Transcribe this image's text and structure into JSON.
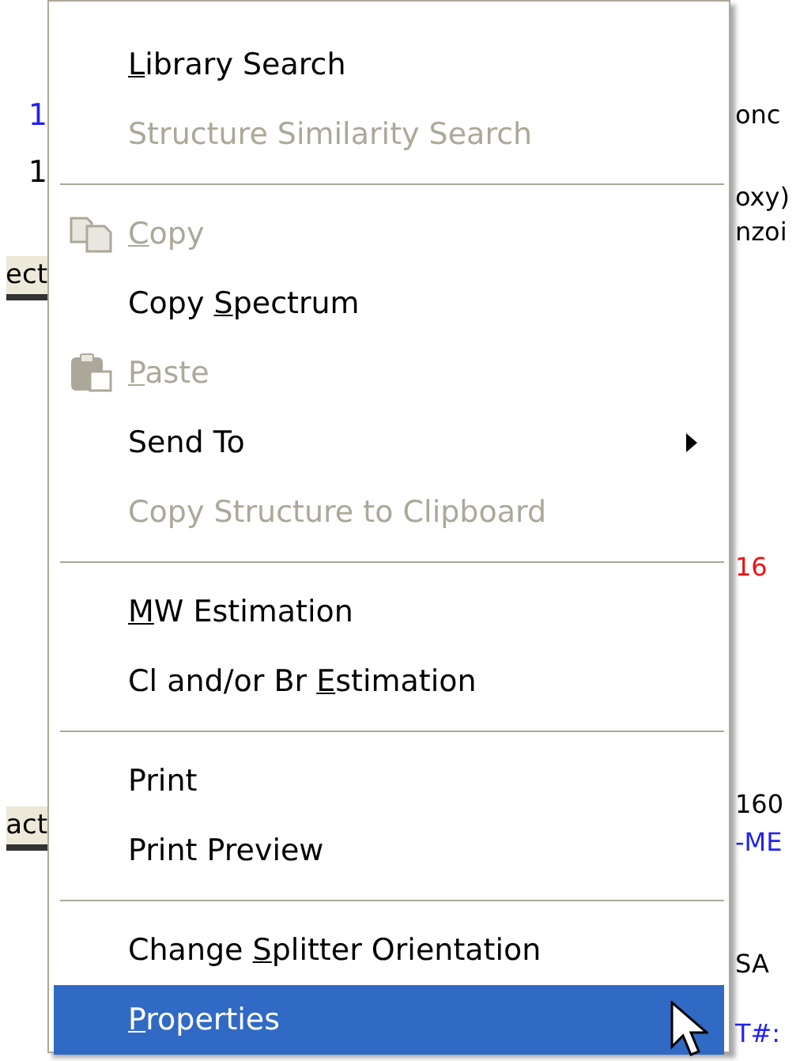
{
  "background": {
    "left": [
      {
        "text": "1",
        "kind": "link"
      },
      {
        "text": "1",
        "kind": "plain"
      },
      {
        "text": "ect",
        "kind": "button"
      },
      {
        "text": "act",
        "kind": "button"
      }
    ],
    "right": [
      {
        "text": "onc",
        "kind": "plain"
      },
      {
        "text": "oxy)",
        "kind": "plain"
      },
      {
        "text": "nzoi",
        "kind": "plain"
      },
      {
        "text": "16",
        "kind": "peak"
      },
      {
        "text": "160",
        "kind": "plain"
      },
      {
        "text": "-ME",
        "kind": "link"
      },
      {
        "text": "SA",
        "kind": "plain"
      },
      {
        "text": "T#:",
        "kind": "link"
      }
    ]
  },
  "menu": [
    {
      "kind": "item",
      "mnemonic": "L",
      "label_rest": "ibrary Search",
      "disabled": false,
      "selected": false
    },
    {
      "kind": "item",
      "label": "Structure Similarity Search",
      "disabled": true,
      "selected": false
    },
    {
      "kind": "separator"
    },
    {
      "kind": "copy",
      "mnemonic": "C",
      "label_rest": "opy",
      "disabled": true,
      "selected": false
    },
    {
      "kind": "item",
      "label": "Copy ",
      "mnemonic": "S",
      "label_rest": "pectrum",
      "disabled": false,
      "selected": false
    },
    {
      "kind": "paste",
      "mnemonic": "P",
      "label_rest": "aste",
      "disabled": true,
      "selected": false
    },
    {
      "kind": "submenu",
      "label": "Send To",
      "disabled": false,
      "selected": false
    },
    {
      "kind": "item",
      "label": "Copy Structure to Clipboard",
      "disabled": true,
      "selected": false
    },
    {
      "kind": "separator"
    },
    {
      "kind": "item",
      "mnemonic": "M",
      "label_rest": "W Estimation",
      "disabled": false,
      "selected": false
    },
    {
      "kind": "item",
      "label": "Cl and/or Br ",
      "mnemonic": "E",
      "label_rest": "stimation",
      "disabled": false,
      "selected": false
    },
    {
      "kind": "separator"
    },
    {
      "kind": "item",
      "label": "Print",
      "disabled": false,
      "selected": false
    },
    {
      "kind": "item",
      "label": "Print Preview",
      "disabled": false,
      "selected": false
    },
    {
      "kind": "separator"
    },
    {
      "kind": "item",
      "label": "Change ",
      "mnemonic": "S",
      "label_rest": "plitter Orientation",
      "disabled": false,
      "selected": false
    },
    {
      "kind": "item",
      "mnemonic": "P",
      "label_rest": "roperties",
      "disabled": false,
      "selected": true
    }
  ]
}
